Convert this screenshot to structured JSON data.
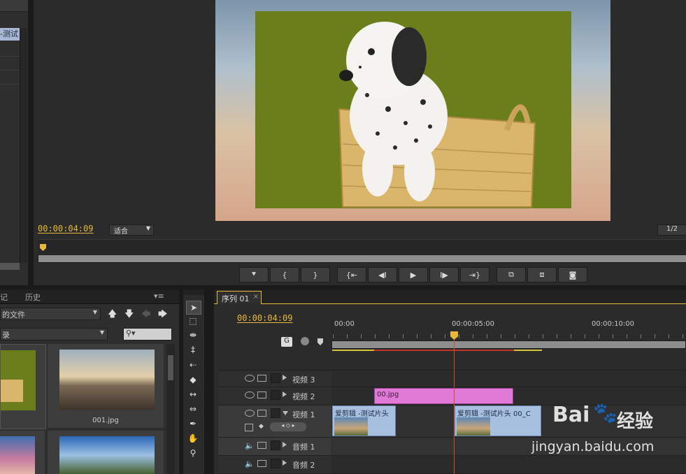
{
  "program_monitor": {
    "timecode": "00:00:04:09",
    "fit_label": "适合",
    "resolution": "1/2"
  },
  "transport_icons": [
    "marker-icon",
    "in-point-icon",
    "out-point-icon",
    "go-to-in-icon",
    "step-back-icon",
    "play-icon",
    "step-forward-icon",
    "go-to-out-icon",
    "lift-icon",
    "extract-icon",
    "export-frame-icon"
  ],
  "left_panel": {
    "top_item_label": "-测试",
    "tabs": [
      "记",
      "历史"
    ],
    "dropdown1": "的文件",
    "dropdown2": "录",
    "thumbs": [
      {
        "label": ""
      },
      {
        "label": "001.jpg"
      }
    ]
  },
  "sequence": {
    "tab_label": "序列 01",
    "tab_close": "×",
    "timecode": "00:00:04:09",
    "ruler": [
      "00:00",
      "00:00:05:00",
      "00:00:10:00"
    ],
    "tracks": [
      {
        "name": "视频 3",
        "type": "video"
      },
      {
        "name": "视频 2",
        "type": "video"
      },
      {
        "name": "视频 1",
        "type": "video"
      },
      {
        "name": "音频 1",
        "type": "audio"
      },
      {
        "name": "音频 2",
        "type": "audio"
      }
    ],
    "clips": {
      "v2": "00.jpg",
      "v1a": "爱剪辑 -测试片头",
      "v1b": "爱剪辑 -测试片头 00_C"
    }
  },
  "watermark": {
    "brand": "Bai",
    "brand_suffix": "经验",
    "url": "jingyan.baidu.com"
  },
  "colors": {
    "accent_timecode": "#e8b93a",
    "monitor_bg": "#6a7f1c",
    "clip_pink": "#e07ad6",
    "playhead": "#d24a2a"
  }
}
